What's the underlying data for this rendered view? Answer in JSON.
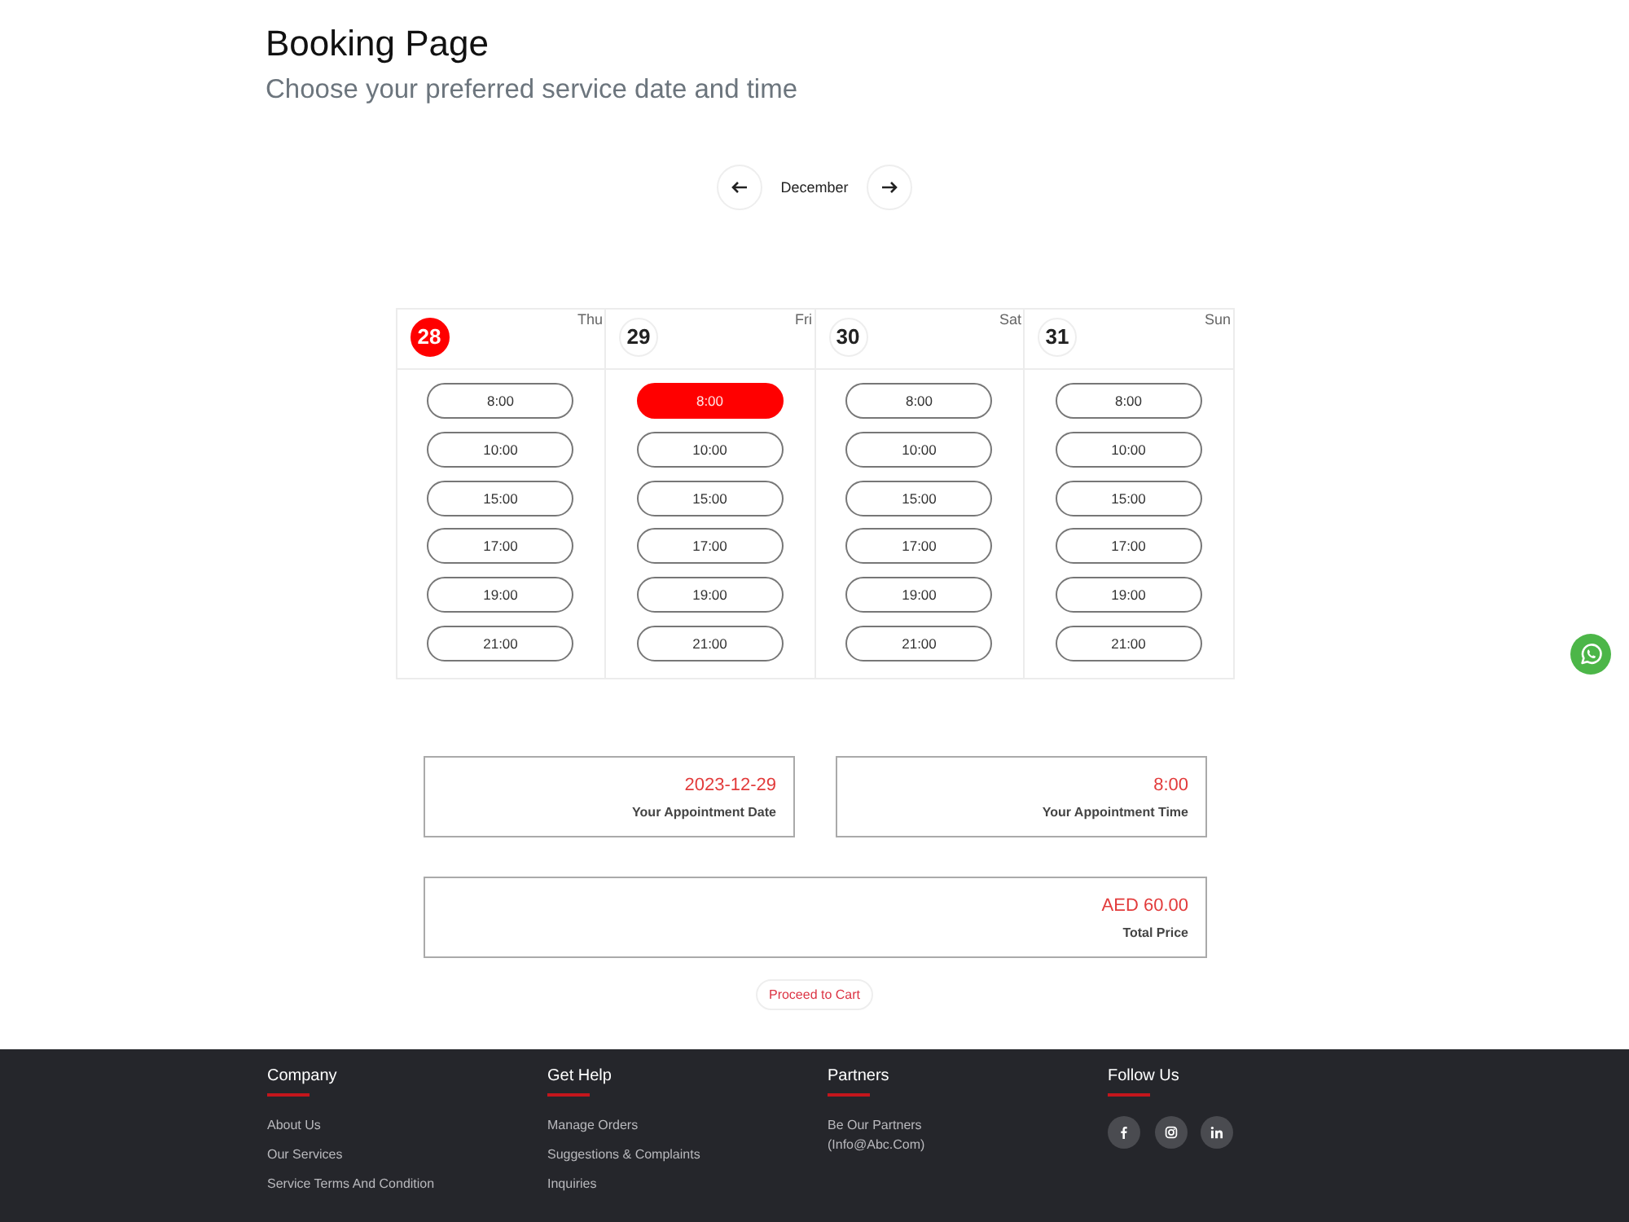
{
  "header": {
    "title": "Booking Page",
    "subtitle": "Choose your preferred service date and time"
  },
  "month_nav": {
    "month": "December"
  },
  "days": [
    {
      "date": "28",
      "weekday": "Thu",
      "today": true,
      "slots": [
        {
          "time": "8:00",
          "selected": false
        },
        {
          "time": "10:00",
          "selected": false
        },
        {
          "time": "15:00",
          "selected": false
        },
        {
          "time": "17:00",
          "selected": false
        },
        {
          "time": "19:00",
          "selected": false
        },
        {
          "time": "21:00",
          "selected": false
        }
      ]
    },
    {
      "date": "29",
      "weekday": "Fri",
      "today": false,
      "slots": [
        {
          "time": "8:00",
          "selected": true
        },
        {
          "time": "10:00",
          "selected": false
        },
        {
          "time": "15:00",
          "selected": false
        },
        {
          "time": "17:00",
          "selected": false
        },
        {
          "time": "19:00",
          "selected": false
        },
        {
          "time": "21:00",
          "selected": false
        }
      ]
    },
    {
      "date": "30",
      "weekday": "Sat",
      "today": false,
      "slots": [
        {
          "time": "8:00",
          "selected": false
        },
        {
          "time": "10:00",
          "selected": false
        },
        {
          "time": "15:00",
          "selected": false
        },
        {
          "time": "17:00",
          "selected": false
        },
        {
          "time": "19:00",
          "selected": false
        },
        {
          "time": "21:00",
          "selected": false
        }
      ]
    },
    {
      "date": "31",
      "weekday": "Sun",
      "today": false,
      "slots": [
        {
          "time": "8:00",
          "selected": false
        },
        {
          "time": "10:00",
          "selected": false
        },
        {
          "time": "15:00",
          "selected": false
        },
        {
          "time": "17:00",
          "selected": false
        },
        {
          "time": "19:00",
          "selected": false
        },
        {
          "time": "21:00",
          "selected": false
        }
      ]
    }
  ],
  "summary": [
    {
      "value": "2023-12-29",
      "label": "Your Appointment Date"
    },
    {
      "value": "8:00",
      "label": "Your Appointment Time"
    }
  ],
  "total": {
    "value": "AED 60.00",
    "label": "Total Price"
  },
  "proceed_button": {
    "label": "Proceed to Cart"
  },
  "footer": {
    "columns": [
      {
        "kind": "links",
        "heading": "Company",
        "links": [
          "About Us",
          "Our Services",
          "Service Terms And Condition"
        ]
      },
      {
        "kind": "links",
        "heading": "Get Help",
        "links": [
          "Manage Orders",
          "Suggestions & Complaints",
          "Inquiries"
        ]
      },
      {
        "kind": "text",
        "heading": "Partners",
        "text": "Be Our Partners (Info@Abc.Com)"
      },
      {
        "kind": "social",
        "heading": "Follow Us"
      }
    ]
  }
}
